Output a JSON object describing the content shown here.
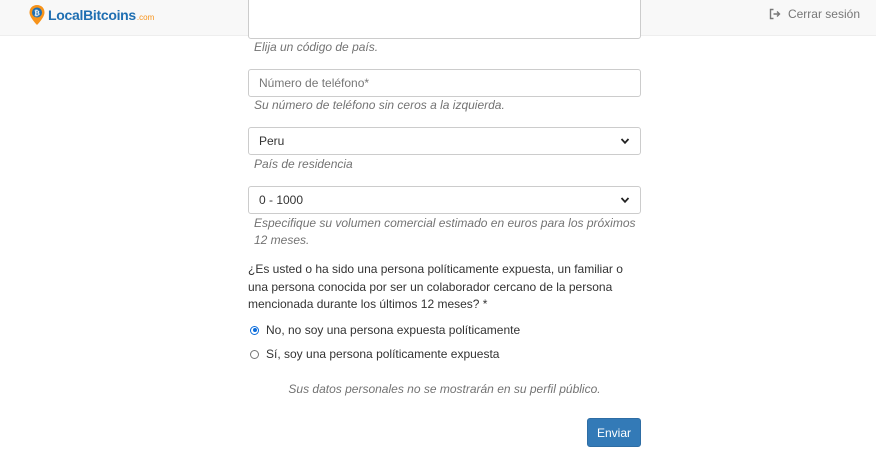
{
  "header": {
    "logo_text": "LocalBitcoins",
    "logo_suffix": ".com",
    "logout_label": "Cerrar sesión"
  },
  "form": {
    "country_code_help": "Elija un código de país.",
    "phone_placeholder": "Número de teléfono*",
    "phone_help": "Su número de teléfono sin ceros a la izquierda.",
    "residence_value": "Peru",
    "residence_help": "País de residencia",
    "volume_value": "0 - 1000",
    "volume_help_line1": "Especifique su volumen comercial estimado en euros para los próximos",
    "volume_help_line2": "12 meses.",
    "pep_question_line1": "¿Es usted o ha sido una persona políticamente expuesta, un familiar o",
    "pep_question_line2": "una persona conocida por ser un colaborador cercano de la persona",
    "pep_question_line3": "mencionada durante los últimos 12 meses? *",
    "pep_options": [
      {
        "label": "No, no soy una persona expuesta políticamente",
        "checked": true
      },
      {
        "label": "Sí, soy una persona políticamente expuesta",
        "checked": false
      }
    ],
    "privacy_note": "Sus datos personales no se mostrarán en su perfil público.",
    "submit_label": "Enviar"
  },
  "colors": {
    "brand_blue": "#1f6fb2",
    "brand_orange": "#f7931a",
    "primary_button": "#337ab7",
    "radio_checked": "#0b6cdb"
  }
}
